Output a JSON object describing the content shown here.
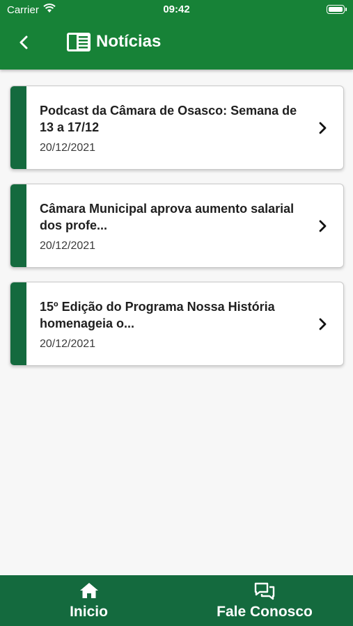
{
  "status_bar": {
    "carrier": "Carrier",
    "time": "09:42"
  },
  "header": {
    "title": "Notícias",
    "back_icon": "chevron-left-icon",
    "title_icon": "newspaper-icon"
  },
  "news": [
    {
      "title": "Podcast da Câmara de Osasco: Semana de 13 a 17/12",
      "date": "20/12/2021"
    },
    {
      "title": "Câmara Municipal aprova aumento salarial dos profe...",
      "date": "20/12/2021"
    },
    {
      "title": "15º Edição do Programa Nossa História homenageia o...",
      "date": "20/12/2021"
    }
  ],
  "tab_bar": {
    "home": {
      "label": "Inicio",
      "icon": "home-icon"
    },
    "contact": {
      "label": "Fale Conosco",
      "icon": "chat-bubbles-icon"
    }
  },
  "colors": {
    "primary": "#178237",
    "accent_dark": "#146a3e",
    "background": "#f7f7f7"
  }
}
